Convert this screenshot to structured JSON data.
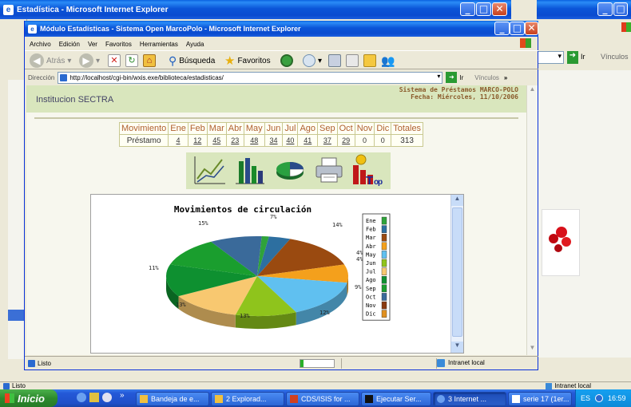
{
  "outer": {
    "title": "Estadística - Microsoft Internet Explorer",
    "status": "Listo",
    "zone": "Intranet local",
    "go_label": "Ir",
    "links_label": "Vínculos"
  },
  "inner": {
    "title": "Módulo Estadísticas - Sistema Open MarcoPolo - Microsoft Internet Explorer",
    "menu": [
      "Archivo",
      "Edición",
      "Ver",
      "Favoritos",
      "Herramientas",
      "Ayuda"
    ],
    "toolbar": {
      "back": "Atrás",
      "search": "Búsqueda",
      "favorites": "Favoritos"
    },
    "address_label": "Dirección",
    "address": "http://localhost/cgi-bin/wxis.exe/biblioteca/estadisticas/",
    "go_label": "Ir",
    "links_label": "Vínculos",
    "status": "Listo",
    "zone": "Intranet local"
  },
  "page": {
    "institution": "Institucion SECTRA",
    "system_name": "Sistema de Préstamos MARCO-POLO",
    "date": "Fecha: Miércoles, 11/10/2006",
    "table": {
      "headers": [
        "Movimiento",
        "Ene",
        "Feb",
        "Mar",
        "Abr",
        "May",
        "Jun",
        "Jul",
        "Ago",
        "Sep",
        "Oct",
        "Nov",
        "Dic",
        "Totales"
      ],
      "row": [
        "Préstamo",
        "4",
        "12",
        "45",
        "23",
        "48",
        "34",
        "40",
        "41",
        "37",
        "29",
        "0",
        "0",
        "313"
      ]
    },
    "icons": [
      "line-chart-icon",
      "bar-chart-icon",
      "pie-chart-icon",
      "printer-icon",
      "top-icon"
    ]
  },
  "chart_data": {
    "type": "pie",
    "title": "Movimientos de circulación",
    "categories": [
      "Ene",
      "Feb",
      "Mar",
      "Abr",
      "May",
      "Jun",
      "Jul",
      "Ago",
      "Sep",
      "Oct",
      "Nov",
      "Dic"
    ],
    "values": [
      4,
      12,
      45,
      23,
      48,
      34,
      40,
      41,
      37,
      29,
      0,
      0
    ],
    "slice_labels": [
      "7%",
      "14%",
      "4%",
      "4%",
      "9%",
      "12%",
      "13%",
      "13%",
      "11%",
      "15%"
    ],
    "colors": [
      "#2fa33a",
      "#2d6fa0",
      "#9a4a10",
      "#f4a01c",
      "#60c0f0",
      "#8fc41c",
      "#f8c870",
      "#0e9030",
      "#1a9e2e",
      "#3a6a9a",
      "#8a3a10",
      "#e09020"
    ],
    "legend_position": "right"
  },
  "taskbar": {
    "start": "Inicio",
    "tasks": [
      "Bandeja de e...",
      "2 Explorad...",
      "CDS/ISIS for ...",
      "Ejecutar Ser...",
      "3 Internet ...",
      "serie 17 (1er..."
    ],
    "lang": "ES",
    "clock": "16:59"
  }
}
